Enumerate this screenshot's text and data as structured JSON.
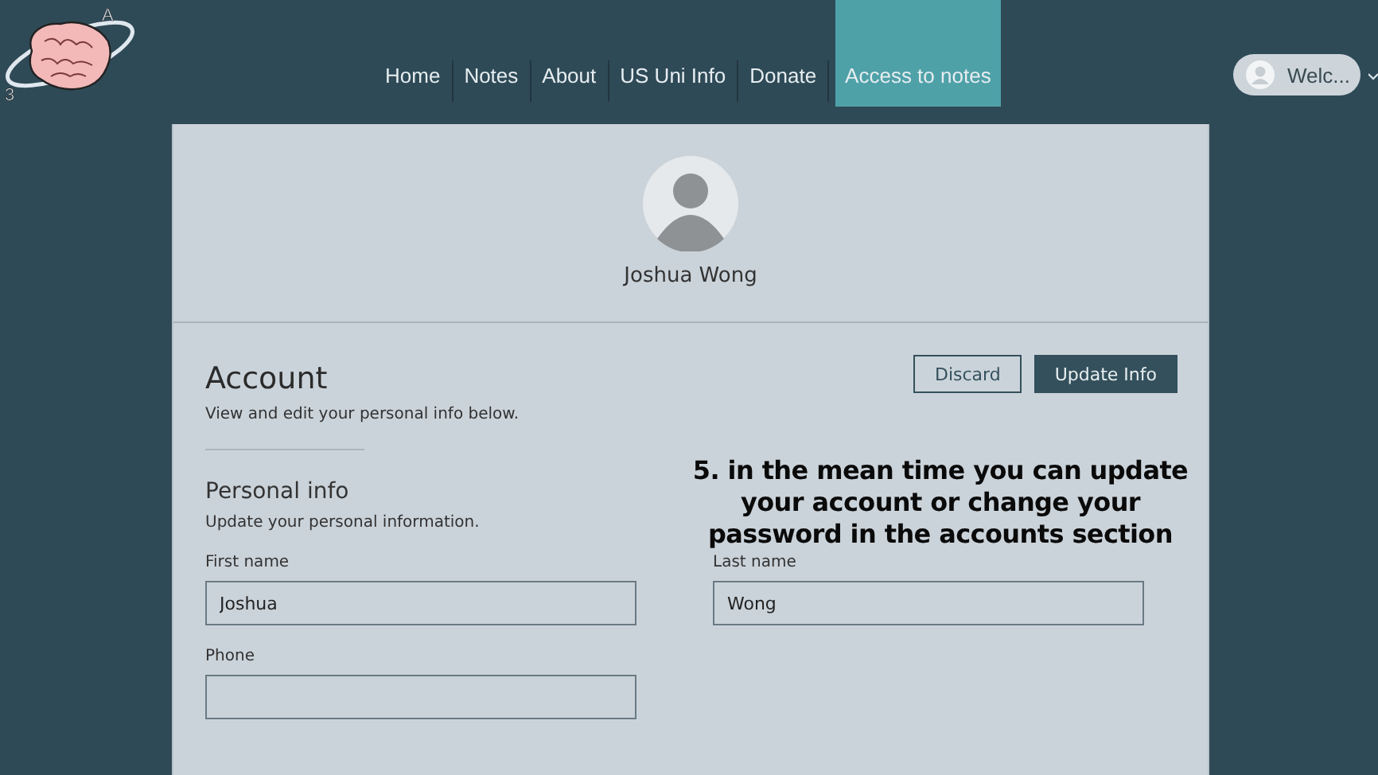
{
  "logo": {
    "marks": [
      "A",
      "3"
    ]
  },
  "nav": [
    {
      "label": "Home",
      "selected": false
    },
    {
      "label": "Notes",
      "selected": false
    },
    {
      "label": "About",
      "selected": false
    },
    {
      "label": "US Uni Info",
      "selected": false
    },
    {
      "label": "Donate",
      "selected": false
    },
    {
      "label": "Access to notes",
      "selected": true
    }
  ],
  "user_menu": {
    "label": "Welc..."
  },
  "profile": {
    "name": "Joshua Wong"
  },
  "account": {
    "title": "Account",
    "subtitle": "View and edit your personal info below.",
    "buttons": [
      {
        "label": "Discard",
        "kind": "secondary"
      },
      {
        "label": "Update Info",
        "kind": "primary"
      }
    ]
  },
  "personal_info": {
    "title": "Personal info",
    "subtitle": "Update your personal information.",
    "fields": [
      {
        "label": "First name",
        "value": "Joshua"
      },
      {
        "label": "Last name",
        "value": "Wong"
      },
      {
        "label": "Phone"
      }
    ]
  },
  "caption": "5. in the mean time you can update your account or change your password in the accounts section"
}
